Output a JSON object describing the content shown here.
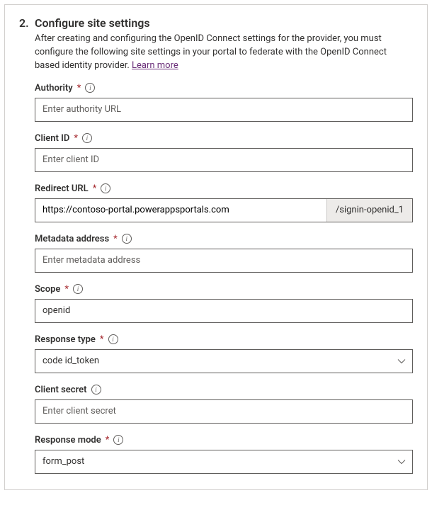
{
  "step": {
    "number": "2.",
    "title": "Configure site settings",
    "description_before": "After creating and configuring the OpenID Connect settings for the provider, you must configure the following site settings in your portal to federate with the OpenID Connect based identity provider. ",
    "learn_more": "Learn more"
  },
  "fields": {
    "authority": {
      "label": "Authority",
      "required": true,
      "placeholder": "Enter authority URL",
      "value": ""
    },
    "client_id": {
      "label": "Client ID",
      "required": true,
      "placeholder": "Enter client ID",
      "value": ""
    },
    "redirect_url": {
      "label": "Redirect URL",
      "required": true,
      "value": "https://contoso-portal.powerappsportals.com",
      "suffix": "/signin-openid_1"
    },
    "metadata": {
      "label": "Metadata address",
      "required": true,
      "placeholder": "Enter metadata address",
      "value": ""
    },
    "scope": {
      "label": "Scope",
      "required": true,
      "placeholder": "",
      "value": "openid"
    },
    "response_type": {
      "label": "Response type",
      "required": true,
      "value": "code id_token"
    },
    "client_secret": {
      "label": "Client secret",
      "required": false,
      "placeholder": "Enter client secret",
      "value": ""
    },
    "response_mode": {
      "label": "Response mode",
      "required": true,
      "value": "form_post"
    }
  }
}
